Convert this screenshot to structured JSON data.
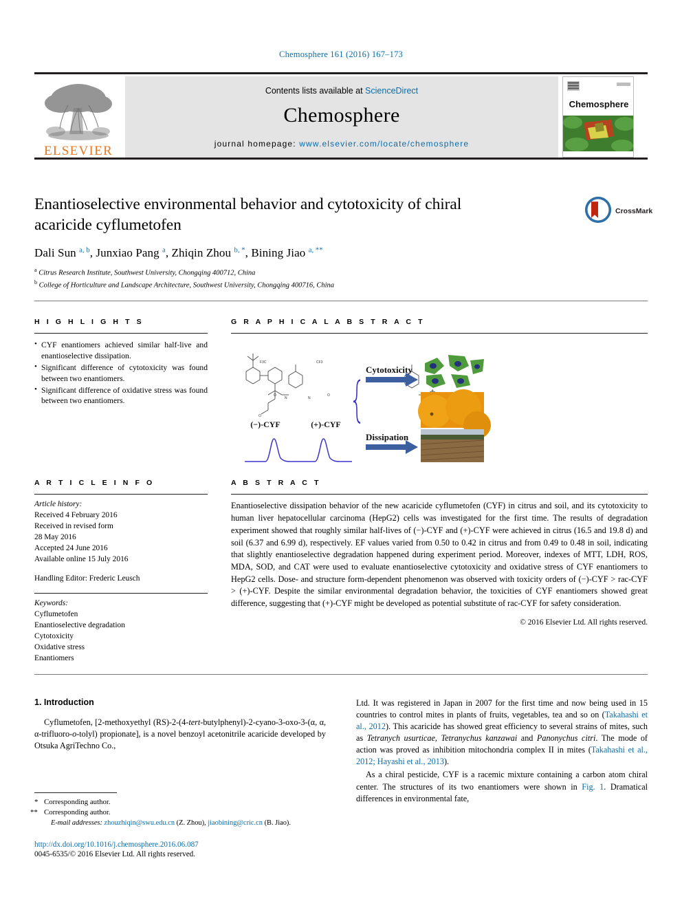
{
  "running_head": "Chemosphere 161 (2016) 167–173",
  "masthead": {
    "contents_prefix": "Contents lists available at",
    "contents_link": "ScienceDirect",
    "journal_name": "Chemosphere",
    "homepage_prefix": "journal homepage:",
    "homepage_url": "www.elsevier.com/locate/chemosphere",
    "publisher_logo_text": "ELSEVIER",
    "cover_title": "Chemosphere"
  },
  "article": {
    "title": "Enantioselective environmental behavior and cytotoxicity of chiral acaricide cyflumetofen",
    "authors_html": "Dali Sun <sup>a, b</sup>, Junxiao Pang <sup>a</sup>, Zhiqin Zhou <sup>b, *</sup>, Bining Jiao <sup>a, **</sup>",
    "affiliation_a": "Citrus Research Institute, Southwest University, Chongqing 400712, China",
    "affiliation_b": "College of Horticulture and Landscape Architecture, Southwest University, Chongqing 400716, China",
    "crossmark_label": "CrossMark"
  },
  "highlights": {
    "heading": "H I G H L I G H T S",
    "items": [
      "CYF enantiomers achieved similar half-live and enantioselective dissipation.",
      "Significant difference of cytotoxicity was found between two enantiomers.",
      "Significant difference of oxidative stress was found between two enantiomers."
    ]
  },
  "graphical_abstract": {
    "heading": "G R A P H I C A L  A B S T R A C T",
    "label_left_enantiomer": "(−)-CYF",
    "label_right_enantiomer": "(+)-CYF",
    "arrow_label_top": "Cytotoxicity",
    "arrow_label_bottom": "Dissipation",
    "structure_labels": [
      "F3C",
      "CF3",
      "O",
      "N"
    ]
  },
  "article_info": {
    "heading": "A R T I C L E  I N F O",
    "history_label": "Article history:",
    "history": [
      "Received 4 February 2016",
      "Received in revised form",
      "28 May 2016",
      "Accepted 24 June 2016",
      "Available online 15 July 2016"
    ],
    "handling_editor": "Handling Editor: Frederic Leusch",
    "keywords_label": "Keywords:",
    "keywords": [
      "Cyflumetofen",
      "Enantioselective degradation",
      "Cytotoxicity",
      "Oxidative stress",
      "Enantiomers"
    ]
  },
  "abstract": {
    "heading": "A B S T R A C T",
    "text": "Enantioselective dissipation behavior of the new acaricide cyflumetofen (CYF) in citrus and soil, and its cytotoxicity to human liver hepatocellular carcinoma (HepG2) cells was investigated for the first time. The results of degradation experiment showed that roughly similar half-lives of (−)-CYF and (+)-CYF were achieved in citrus (16.5 and 19.8 d) and soil (6.37 and 6.99 d), respectively. EF values varied from 0.50 to 0.42 in citrus and from 0.49 to 0.48 in soil, indicating that slightly enantioselective degradation happened during experiment period. Moreover, indexes of MTT, LDH, ROS, MDA, SOD, and CAT were used to evaluate enantioselective cytotoxicity and oxidative stress of CYF enantiomers to HepG2 cells. Dose- and structure form-dependent phenomenon was observed with toxicity orders of (−)-CYF > rac-CYF > (+)-CYF. Despite the similar environmental degradation behavior, the toxicities of CYF enantiomers showed great difference, suggesting that (+)-CYF might be developed as potential substitute of rac-CYF for safety consideration.",
    "copyright": "© 2016 Elsevier Ltd. All rights reserved."
  },
  "body": {
    "section_number_title": "1. Introduction",
    "left_paragraph_1_html": "Cyflumetofen, [2-methoxyethyl (RS)-2-(4-<i>tert</i>-butylphenyl)-2-cyano-3-oxo-3-(α, α, α-trifluoro-<i>o</i>-tolyl) propionate], is a novel benzoyl acetonitrile acaricide developed by Otsuka AgriTechno Co.,",
    "right_paragraph_1_html": "Ltd. It was registered in Japan in 2007 for the first time and now being used in 15 countries to control mites in plants of fruits, vegetables, tea and so on (<span class=\"lnk\">Takahashi et al., 2012</span>). This acaricide has showed great efficiency to several strains of mites, such as <i>Tetranych usurticae</i>, <i>Tetranychus kanzawai</i> and <i>Panonychus citri</i>. The mode of action was proved as inhibition mitochondria complex II in mites (<span class=\"lnk\">Takahashi et al., 2012; Hayashi et al., 2013</span>).",
    "right_paragraph_2_html": "As a chiral pesticide, CYF is a racemic mixture containing a carbon atom chiral center. The structures of its two enantiomers were shown in <span class=\"lnk\">Fig. 1</span>. Dramatical differences in environmental fate,"
  },
  "footnotes": {
    "corresponding_1": "Corresponding author.",
    "corresponding_2": "Corresponding author.",
    "emails_label": "E-mail addresses:",
    "email_1": "zhouzhiqin@swu.edu.cn",
    "email_1_owner": "(Z. Zhou),",
    "email_2": "jiaobining@cric.cn",
    "email_2_owner": "(B. Jiao)."
  },
  "footer": {
    "doi": "http://dx.doi.org/10.1016/j.chemosphere.2016.06.087",
    "issn_line": "0045-6535/© 2016 Elsevier Ltd. All rights reserved."
  },
  "colors": {
    "link_blue": "#0b6ca8",
    "elsevier_orange": "#E87722",
    "rule_black": "#231f20",
    "masthead_gray": "#e4e4e4",
    "chromatogram_blue": "#3b34c9",
    "arrow_blue": "#2f4f9b",
    "cell_green": "#4f9a3d"
  }
}
